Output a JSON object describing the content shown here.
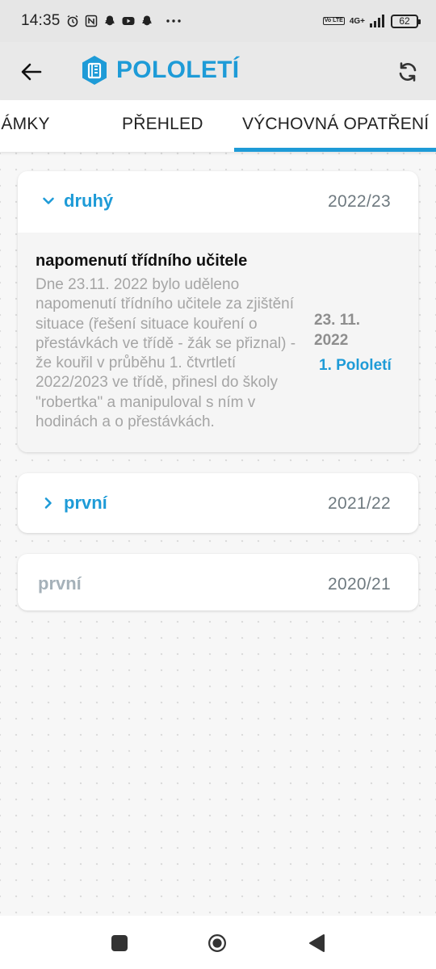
{
  "status_bar": {
    "time": "14:35",
    "left_icons": [
      "alarm-icon",
      "nfc-icon",
      "snapchat-icon",
      "youtube-icon",
      "snapchat-icon",
      "more-dots-icon"
    ],
    "volte": "Vo LTE",
    "network": "4G+",
    "battery": "62"
  },
  "app_bar": {
    "title": "POLOLETÍ",
    "accent_color": "#1e9bd7"
  },
  "tabs": [
    {
      "label": "ZNÁMKY",
      "visible_label": "NÁMKY",
      "active": false
    },
    {
      "label": "PŘEHLED",
      "active": false
    },
    {
      "label": "VÝCHOVNÁ OPATŘENÍ",
      "active": true
    }
  ],
  "semesters": [
    {
      "name": "druhý",
      "year": "2022/23",
      "expanded": true,
      "measures": [
        {
          "title": "napomenutí třídního učitele",
          "description": "Dne  23.11. 2022 bylo uděleno napomenutí třídního učitele za zjištění situace (řešení situace kouření o přestávkách ve třídě - žák se přiznal) - že kouřil v průběhu 1. čtvrtletí 2022/2023 ve třídě, přinesl do školy \"robertka\" a manipuloval s ním v hodinách a o přestávkách.",
          "date": "23. 11. 2022",
          "period": "1. Pololetí"
        }
      ]
    },
    {
      "name": "první",
      "year": "2021/22",
      "expanded": false
    },
    {
      "name": "první",
      "year": "2020/21",
      "expanded": false,
      "disabled": true
    }
  ],
  "nav_bar": {
    "icons": [
      "recent-apps-icon",
      "home-icon",
      "back-triangle-icon"
    ]
  }
}
